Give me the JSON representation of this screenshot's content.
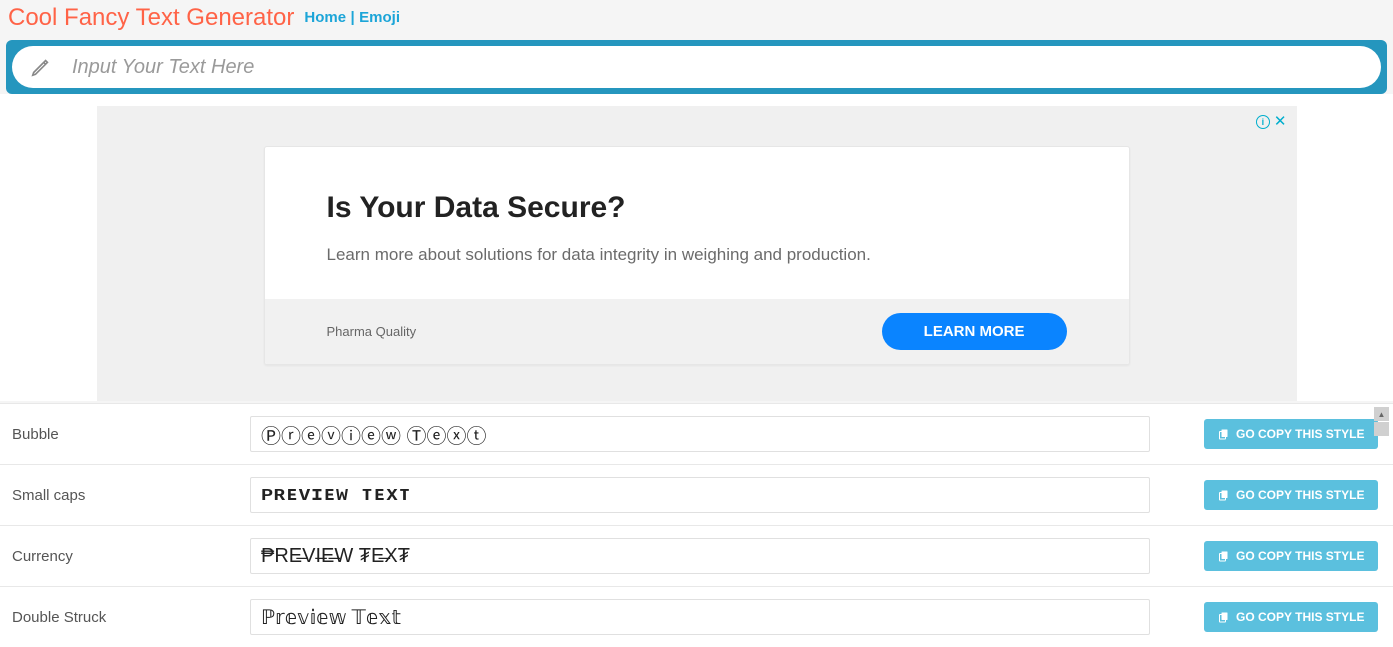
{
  "header": {
    "title": "Cool Fancy Text Generator",
    "nav": {
      "home": "Home",
      "sep": "|",
      "emoji": "Emoji"
    }
  },
  "input": {
    "placeholder": "Input Your Text Here",
    "value": ""
  },
  "ad": {
    "headline": "Is Your Data Secure?",
    "description": "Learn more about solutions for data integrity in weighing and production.",
    "brand": "Pharma Quality",
    "cta": "LEARN MORE",
    "info_glyph": "i",
    "close_glyph": "✕"
  },
  "copy_label": "GO COPY THIS STYLE",
  "styles": [
    {
      "name": "Bubble",
      "preview": "Ⓟⓡⓔⓥⓘⓔⓦ Ⓣⓔⓧⓣ"
    },
    {
      "name": "Small caps",
      "preview": "ᴘʀᴇᴠɪᴇᴡ ᴛᴇxᴛ"
    },
    {
      "name": "Currency",
      "preview": "₱RE̶VI̶E̶W ₮E̶X₮"
    },
    {
      "name": "Double Struck",
      "preview": "ℙ𝕣𝕖𝕧𝕚𝕖𝕨 𝕋𝕖𝕩𝕥"
    }
  ]
}
